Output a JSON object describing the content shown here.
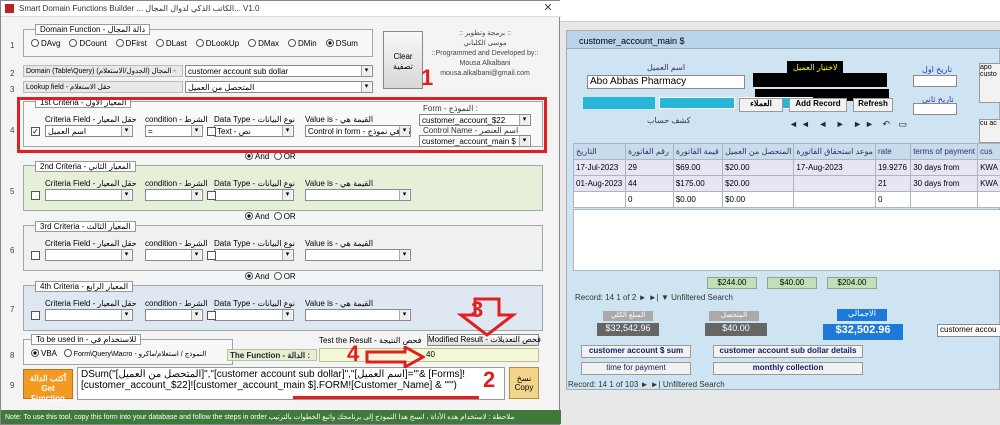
{
  "title": "Smart Domain Functions Builder ... الكاتب الذكي لدوال المجال... V1.0",
  "domain_function": {
    "legend": "Domain Function - دالة المجال",
    "options": [
      "DAvg",
      "DCount",
      "DFirst",
      "DLast",
      "DLookUp",
      "DMax",
      "DMin",
      "DSum"
    ],
    "selected": "DSum"
  },
  "author": {
    "l1": ":: برمجة وتطوير ::",
    "l2": "موسى الكلباني",
    "l3": "::Programmed and Developed by::",
    "l4": "Mousa Alkalbani",
    "l5": "mousa.alkalbani@gmail.com"
  },
  "clear_label": "Clear\nتصفية",
  "domain_row": {
    "label": "Domain (Table\\Query) المجال (الجدول/الاستعلام) -",
    "value": "customer account sub dollar"
  },
  "lookup_row": {
    "label": "Lookup field - حقل الاستعلام",
    "value": "المتحصل من العميل"
  },
  "criteria": [
    {
      "legend": "1st Criteria - المعيار الأول",
      "field": "اسم العميل",
      "condition": "=",
      "type": "Text - نص",
      "valueis": "Control in form - عنصر تحكم في نموذج",
      "checked": true
    },
    {
      "legend": "2nd Criteria - المعيار الثاني",
      "field": "",
      "condition": "",
      "type": "",
      "valueis": "",
      "checked": false
    },
    {
      "legend": "3rd Criteria - المعيار الثالث",
      "field": "",
      "condition": "",
      "type": "",
      "valueis": "",
      "checked": false
    },
    {
      "legend": "4th Criteria - المعيار الرابع",
      "field": "",
      "condition": "",
      "type": "",
      "valueis": "",
      "checked": false
    }
  ],
  "crit_labels": {
    "field": "Criteria Field - حقل المعيار",
    "condition": "condition - الشرط",
    "type": "Data Type - نوع البيانات",
    "valueis": "Value is - القيمة هي"
  },
  "form": {
    "label": "Form - النموذج :",
    "form_value": "customer_account_$22",
    "control_label": "Control Name - اسم العنصر",
    "control_value": "customer_account_main $"
  },
  "and_or": {
    "and": "And",
    "or": "OR"
  },
  "used_in": {
    "legend": "To be used in - للاستخدام في",
    "vba": "VBA",
    "form": "Form\\Query\\Macro - النموذج / استعلام/ماكرو"
  },
  "test": {
    "label": "Test the Result - فحص النتيجة",
    "button": "Modified Result - فحص التعديلات",
    "result": "40"
  },
  "function_label": "The Function - الدالة :",
  "get_function": "أكتب الدالة Get Function",
  "copy_label": "نسخ Copy",
  "function_text": "DSum(\"[المتحصل من العميل]\",\"[customer account sub dollar]\",\"[اسم العميل]='\"& [Forms]![customer_account_$22]![customer_account_main $].FORM![Customer_Name] & \"'\")",
  "note": "Note: To use this tool, copy this form into your database and follow the steps in order      ملاحظة : لاستخدام هذه الأداة ، انسخ هذا النموذج إلى برنامجك واتبع الخطوات بالترتيب",
  "row_numbers": [
    "1",
    "2",
    "3",
    "4",
    "5",
    "6",
    "7",
    "8",
    "9"
  ],
  "annotations": [
    "1",
    "2",
    "3",
    "4"
  ],
  "right": {
    "title": "customer_account_main $",
    "customer_label": "اسم العميل",
    "customer_value": "Abo Abbas Pharmacy",
    "choose_label": "لاختيار العميل",
    "date_from": "تاريخ اول",
    "date_to": "تاريخ ثاني",
    "clients_btn": "العملاء",
    "add_btn": "Add Record",
    "refresh_btn": "Refresh",
    "title_small": "كشف حساب",
    "headers": [
      "التاريخ",
      "رقم الفاتورة",
      "قيمة الفاتورة",
      "المتحصل من العميل",
      "موعد استحقاق الفاتورة",
      "rate",
      "terms of payment",
      "cus"
    ],
    "rows": [
      [
        "17-Jul-2023",
        "29",
        "$69.00",
        "$20.00",
        "17-Aug-2023",
        "19.9276",
        "30 days from",
        "KWA"
      ],
      [
        "01-Aug-2023",
        "44",
        "$175.00",
        "$20.00",
        "",
        "21",
        "30 days from",
        "KWA"
      ],
      [
        "",
        "0",
        "$0.00",
        "$0.00",
        "",
        "0",
        "",
        ""
      ]
    ],
    "totals": [
      "$244.00",
      "$40.00",
      "$204.00"
    ],
    "record_nav": "Record: 14  1 of 2  ► ►|  ▼ Unfiltered  Search",
    "sum1_label": "المبلغ الكلي",
    "sum1": "$32,542.96",
    "sum2_label": "المتحصل",
    "sum2": "$40.00",
    "total_label": "الاجمالي",
    "total": "$32,502.96",
    "cust_field": "customer accou",
    "btn1": "customer account $ sum",
    "btn2": "customer account sub dollar details",
    "btn3": "time for payment",
    "btn4": "monthly collection",
    "record_nav2": "Record: 14  1 of 103  ► ►|  Unfiltered  Search",
    "side_btns": [
      "apo custo",
      "cu ac"
    ]
  }
}
